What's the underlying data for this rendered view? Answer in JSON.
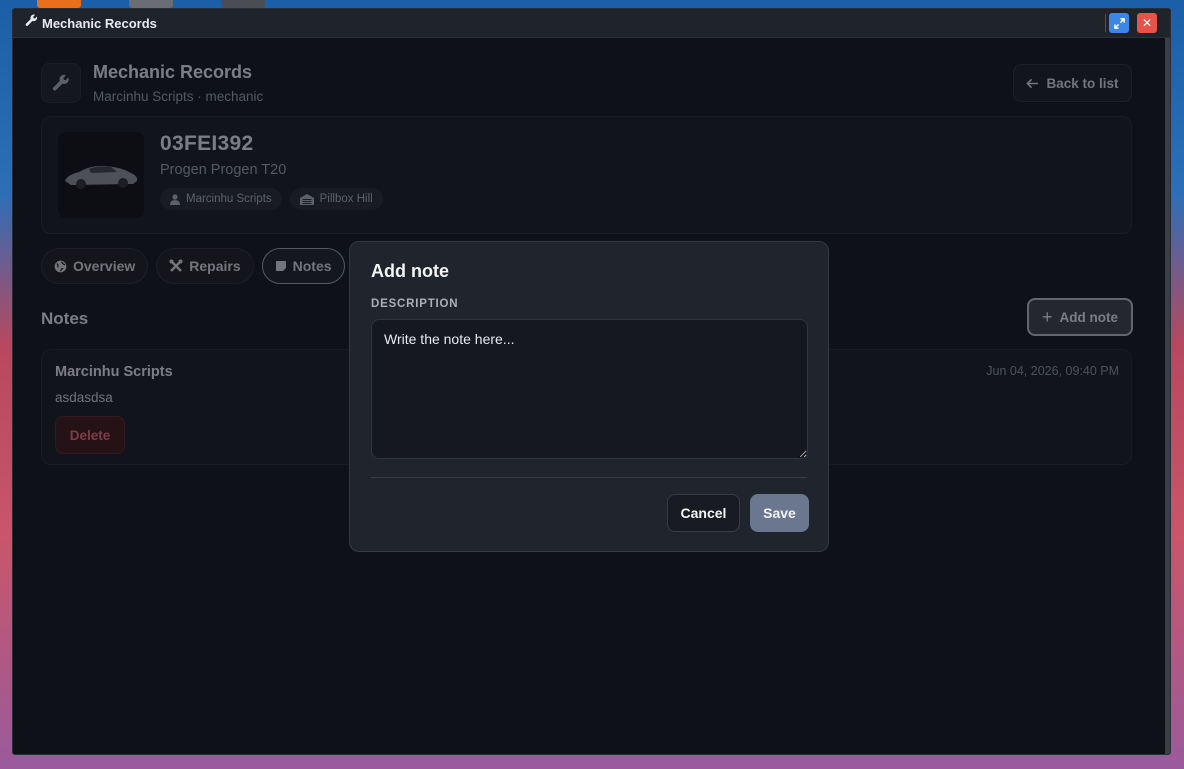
{
  "window": {
    "title": "Mechanic Records",
    "close_glyph": "✕"
  },
  "header": {
    "title": "Mechanic Records",
    "subtitle": "Marcinhu Scripts · mechanic",
    "icon": "wrench-icon"
  },
  "back_button": {
    "label": "Back to list",
    "icon": "arrow-left-icon"
  },
  "vehicle": {
    "plate": "03FEI392",
    "model": "Progen Progen T20",
    "owner": "Marcinhu Scripts",
    "garage": "Pillbox Hill"
  },
  "tabs": [
    {
      "label": "Overview",
      "icon": "globe-icon",
      "active": false
    },
    {
      "label": "Repairs",
      "icon": "tools-icon",
      "active": false
    },
    {
      "label": "Notes",
      "icon": "note-icon",
      "active": true
    }
  ],
  "notes_section": {
    "title": "Notes",
    "add_label": "Add note",
    "items": [
      {
        "author": "Marcinhu Scripts",
        "text": "asdasdsa",
        "date": "Jun 04, 2026, 09:40 PM",
        "delete_label": "Delete"
      }
    ]
  },
  "modal": {
    "title": "Add note",
    "description_label": "DESCRIPTION",
    "placeholder": "Write the note here...",
    "cancel_label": "Cancel",
    "save_label": "Save"
  },
  "colors": {
    "accent": "#3c86e6",
    "danger": "#e5534b",
    "save_button": "#6b778f",
    "background": "#0e1117"
  }
}
